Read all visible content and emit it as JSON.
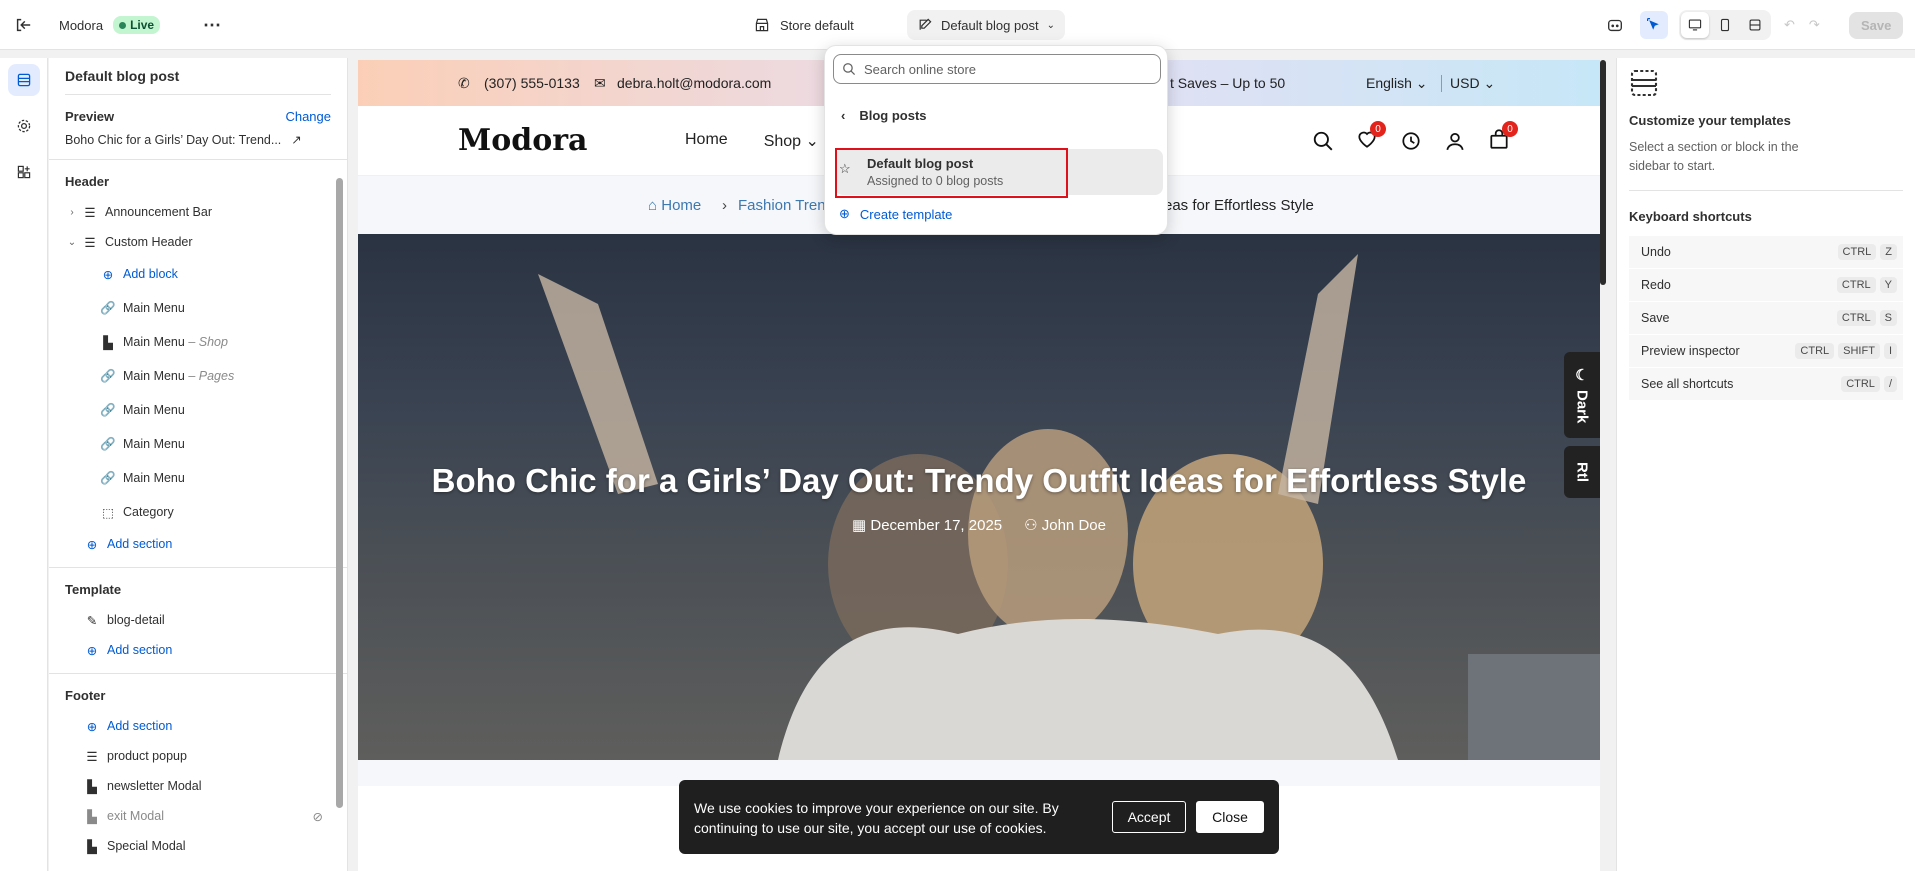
{
  "topbar": {
    "store_name": "Modora",
    "status_label": "Live",
    "theme_label": "Store default",
    "template_label": "Default blog post",
    "save_label": "Save"
  },
  "sidebar": {
    "title": "Default blog post",
    "preview_label": "Preview",
    "change_label": "Change",
    "preview_value": "Boho Chic for a Girls’ Day Out: Trend...",
    "header_section": "Header",
    "header_items": [
      {
        "label": "Announcement Bar",
        "suffix": ""
      },
      {
        "label": "Custom Header",
        "suffix": ""
      },
      {
        "label": "Add block",
        "suffix": ""
      },
      {
        "label": "Main Menu",
        "suffix": ""
      },
      {
        "label": "Main Menu",
        "suffix": "– Shop"
      },
      {
        "label": "Main Menu",
        "suffix": "– Pages"
      },
      {
        "label": "Main Menu",
        "suffix": ""
      },
      {
        "label": "Main Menu",
        "suffix": ""
      },
      {
        "label": "Main Menu",
        "suffix": ""
      },
      {
        "label": "Category",
        "suffix": ""
      }
    ],
    "add_section": "Add section",
    "template_section": "Template",
    "template_item": "blog-detail",
    "footer_section": "Footer",
    "footer_items": [
      "product popup",
      "newsletter Modal",
      "exit Modal",
      "Special Modal"
    ]
  },
  "preview": {
    "phone": "(307) 555-0133",
    "email": "debra.holt@modora.com",
    "promo": "t Saves – Up to 50",
    "language": "English",
    "currency": "USD",
    "logo": "Modora",
    "nav": [
      "Home",
      "Shop"
    ],
    "wishlist_count": "0",
    "cart_count": "0",
    "breadcrumb_home": "Home",
    "breadcrumb_mid": "Fashion Trend",
    "breadcrumb_tail": "eas for Effortless Style",
    "hero_title": "Boho Chic for a Girls’ Day Out: Trendy Outfit Ideas for Effortless Style",
    "hero_date": "December 17, 2025",
    "hero_author": "John Doe",
    "tab_dark": "Dark",
    "tab_rtl": "Rtl",
    "cookie_text": "We use cookies to improve your experience on our site. By continuing to use our site, you accept our use of cookies.",
    "cookie_accept": "Accept",
    "cookie_close": "Close"
  },
  "dropdown": {
    "search_placeholder": "Search online store",
    "back_label": "Blog posts",
    "selected_title": "Default blog post",
    "selected_sub": "Assigned to 0 blog posts",
    "create_label": "Create template"
  },
  "rpanel": {
    "title": "Customize your templates",
    "desc": "Select a section or block in the sidebar to start.",
    "shortcuts_title": "Keyboard shortcuts",
    "shortcuts": [
      {
        "label": "Undo",
        "keys": [
          "CTRL",
          "Z"
        ]
      },
      {
        "label": "Redo",
        "keys": [
          "CTRL",
          "Y"
        ]
      },
      {
        "label": "Save",
        "keys": [
          "CTRL",
          "S"
        ]
      },
      {
        "label": "Preview inspector",
        "keys": [
          "CTRL",
          "SHIFT",
          "I"
        ]
      },
      {
        "label": "See all shortcuts",
        "keys": [
          "CTRL",
          "/"
        ]
      }
    ]
  }
}
